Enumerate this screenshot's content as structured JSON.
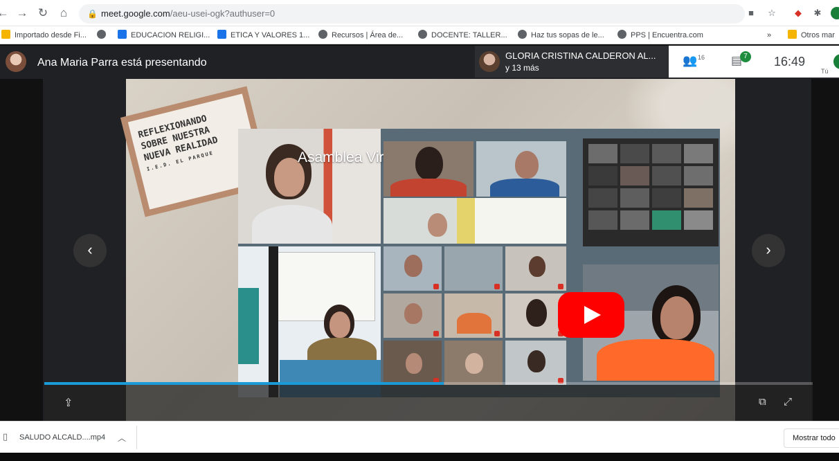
{
  "browser": {
    "url_host": "meet.google.com",
    "url_path": "/aeu-usei-ogk?authuser=0",
    "bookmarks": [
      {
        "label": "Importado desde Fi...",
        "color": "#f4b400"
      },
      {
        "label": "",
        "color": "#5f6368"
      },
      {
        "label": "EDUCACION RELIGI...",
        "color": "#1a73e8"
      },
      {
        "label": "ETICA Y VALORES 1...",
        "color": "#1a73e8"
      },
      {
        "label": "Recursos | Área de...",
        "color": "#5f6368"
      },
      {
        "label": "DOCENTE: TALLER...",
        "color": "#5f6368"
      },
      {
        "label": "Haz tus sopas de le...",
        "color": "#5f6368"
      },
      {
        "label": "PPS | Encuentra.com",
        "color": "#5f6368"
      }
    ],
    "bookmarks_overflow": "»",
    "other_bookmarks": "Otros mar"
  },
  "meet": {
    "presenter_text": "Ana Maria Parra está presentando",
    "tile_name": "GLORIA CRISTINA CALDERON AL...",
    "tile_more": "y 13 más",
    "people_count": "16",
    "chat_count": "7",
    "clock": "16:49",
    "you_label": "Tú"
  },
  "slide": {
    "label_lines": [
      "REFLEXIONANDO",
      "SOBRE NUESTRA",
      "NUEVA REALIDAD"
    ],
    "label_sub": "I.E.D. EL PARQUE",
    "video_title": "Asamblea Virtual",
    "progress_fraction": 0.52
  },
  "download": {
    "file_name": "SALUDO ALCALD....mp4",
    "show_all": "Mostrar todo"
  },
  "colors": {
    "accent_progress": "#1a9bd7",
    "youtube_red": "#ff0000",
    "meet_bar": "#202124"
  }
}
